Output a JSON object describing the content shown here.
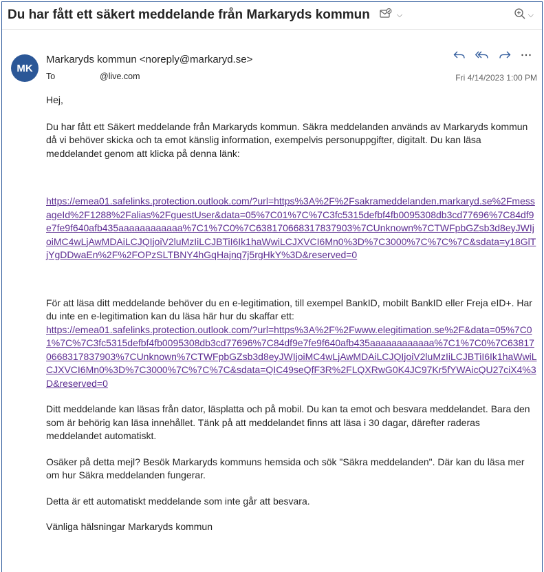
{
  "message": {
    "subject": "Du har fått ett säkert meddelande från Markaryds kommun",
    "avatar_initials": "MK",
    "avatar_color": "#2b5797",
    "sender": "Markaryds kommun <noreply@markaryd.se>",
    "to_label": "To",
    "to_value": "@live.com",
    "date": "Fri 4/14/2023 1:00 PM",
    "icons": {
      "subject": [
        "sensitivity-icon",
        "chevron-down-icon"
      ],
      "zoom": [
        "zoom-icon",
        "chevron-down-icon"
      ],
      "actions": [
        "reply-icon",
        "reply-all-icon",
        "forward-icon",
        "more-icon"
      ]
    }
  },
  "body": {
    "greeting": "Hej,",
    "intro": "Du har fått ett Säkert meddelande från Markaryds kommun. Säkra meddelanden används av Markaryds kommun då vi behöver skicka och ta emot känslig information, exempelvis personuppgifter, digitalt. Du kan läsa meddelandet genom att klicka på denna länk:",
    "link1": "https://emea01.safelinks.protection.outlook.com/?url=https%3A%2F%2Fsakrameddelanden.markaryd.se%2FmessageId%2F1288%2Falias%2FguestUser&data=05%7C01%7C%7C3fc5315defbf4fb0095308db3cd77696%7C84df9e7fe9f640afb435aaaaaaaaaaaa%7C1%7C0%7C638170668317837903%7CUnknown%7CTWFpbGZsb3d8eyJWIjoiMC4wLjAwMDAiLCJQIjoiV2luMzIiLCJBTiI6Ik1haWwiLCJXVCI6Mn0%3D%7C3000%7C%7C%7C&sdata=y18GlTjYgDDwaEn%2F%2FOPzSLTBNY4hGqHajnq7j5rgHkY%3D&reserved=0",
    "eid_text": "För att läsa ditt meddelande behöver du en e-legitimation, till exempel BankID, mobilt BankID eller Freja eID+. Har du inte en e-legitimation kan du läsa här hur du skaffar ett:",
    "link2": "https://emea01.safelinks.protection.outlook.com/?url=https%3A%2F%2Fwww.elegitimation.se%2F&data=05%7C01%7C%7C3fc5315defbf4fb0095308db3cd77696%7C84df9e7fe9f640afb435aaaaaaaaaaaa%7C1%7C0%7C638170668317837903%7CUnknown%7CTWFpbGZsb3d8eyJWIjoiMC4wLjAwMDAiLCJQIjoiV2luMzIiLCJBTiI6Ik1haWwiLCJXVCI6Mn0%3D%7C3000%7C%7C%7C&sdata=QIC49seQfF3R%2FLQXRwG0K4JC97Kr5fYWAicQU27ciX4%3D&reserved=0",
    "info": "Ditt meddelande kan läsas från dator, läsplatta och på mobil. Du kan ta emot och besvara meddelandet. Bara den som är behörig kan läsa innehållet. Tänk på att meddelandet finns att läsa i 30 dagar, därefter raderas meddelandet automatiskt.",
    "unsure": "Osäker på detta mejl? Besök Markaryds kommuns hemsida och sök \"Säkra meddelanden\". Där kan du läsa mer om hur Säkra meddelanden fungerar.",
    "auto": "Detta är ett automatiskt meddelande som inte går att besvara.",
    "closing": "Vänliga hälsningar Markaryds kommun"
  }
}
